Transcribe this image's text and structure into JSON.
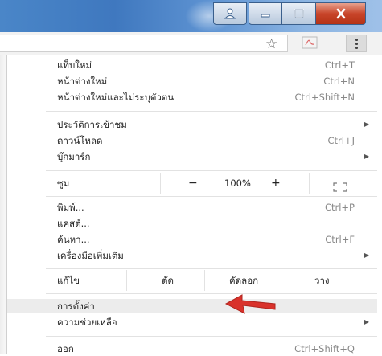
{
  "window": {
    "buttons": [
      {
        "name": "user-icon"
      },
      {
        "name": "minimize-icon"
      },
      {
        "name": "maximize-icon"
      },
      {
        "name": "close-icon"
      }
    ]
  },
  "toolbar": {
    "bookmark_icon": "star-icon",
    "extension_icon": "pdf-extension-icon",
    "menu_icon": "vertical-dots-menu-icon"
  },
  "menu": {
    "new_tab": {
      "label": "แท็บใหม่",
      "shortcut": "Ctrl+T"
    },
    "new_window": {
      "label": "หน้าต่างใหม่",
      "shortcut": "Ctrl+N"
    },
    "incognito": {
      "label": "หน้าต่างใหม่และไม่ระบุตัวตน",
      "shortcut": "Ctrl+Shift+N"
    },
    "history": {
      "label": "ประวัติการเข้าชม"
    },
    "downloads": {
      "label": "ดาวน์โหลด",
      "shortcut": "Ctrl+J"
    },
    "bookmarks": {
      "label": "บุ๊กมาร์ก"
    },
    "zoom": {
      "label": "ซูม",
      "minus": "−",
      "value": "100%",
      "plus": "+",
      "fullscreen_icon": "fullscreen-icon"
    },
    "print": {
      "label": "พิมพ์...",
      "shortcut": "Ctrl+P"
    },
    "cast": {
      "label": "แคสต์..."
    },
    "find": {
      "label": "ค้นหา...",
      "shortcut": "Ctrl+F"
    },
    "more_tools": {
      "label": "เครื่องมือเพิ่มเติม"
    },
    "edit": {
      "label": "แก้ไข",
      "cut": "ตัด",
      "copy": "คัดลอก",
      "paste": "วาง"
    },
    "settings": {
      "label": "การตั้งค่า"
    },
    "help": {
      "label": "ความช่วยเหลือ"
    },
    "exit": {
      "label": "ออก",
      "shortcut": "Ctrl+Shift+Q"
    }
  },
  "colors": {
    "annotation_arrow": "#d9322b",
    "highlight": "#ececec"
  }
}
